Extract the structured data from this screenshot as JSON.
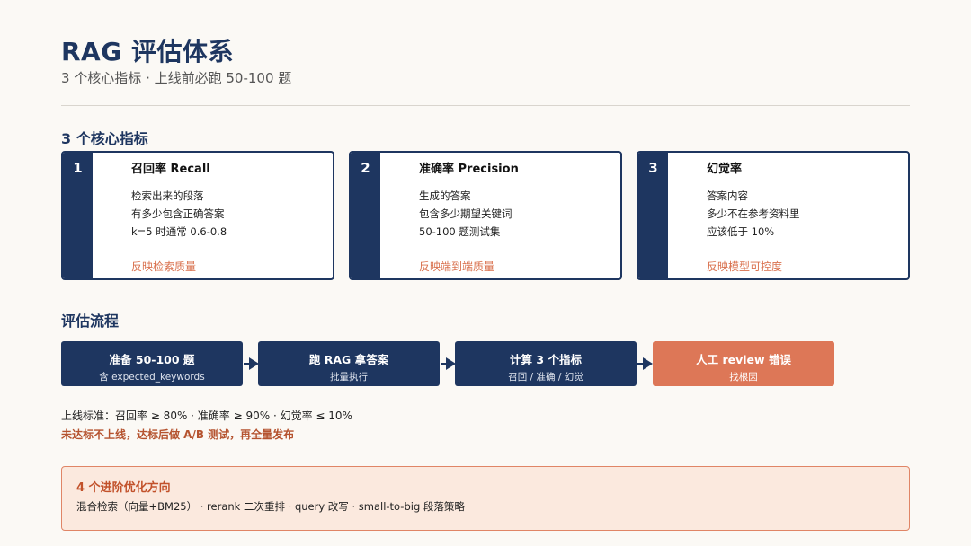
{
  "header": {
    "title": "RAG 评估体系",
    "subtitle": "3 个核心指标 · 上线前必跑 50-100 题"
  },
  "metrics_section": {
    "title": "3 个核心指标",
    "cards": [
      {
        "number": "1",
        "title": "召回率 Recall",
        "lines": [
          "检索出来的段落",
          "有多少包含正确答案",
          "k=5 时通常 0.6-0.8"
        ],
        "note": "反映检索质量"
      },
      {
        "number": "2",
        "title": "准确率 Precision",
        "lines": [
          "生成的答案",
          "包含多少期望关键词",
          "50-100 题测试集"
        ],
        "note": "反映端到端质量"
      },
      {
        "number": "3",
        "title": "幻觉率",
        "lines": [
          "答案内容",
          "多少不在参考资料里",
          "应该低于 10%"
        ],
        "note": "反映模型可控度"
      }
    ]
  },
  "flow_section": {
    "title": "评估流程",
    "steps": [
      {
        "main": "准备 50-100 题",
        "sub": "含 expected_keywords"
      },
      {
        "main": "跑 RAG 拿答案",
        "sub": "批量执行"
      },
      {
        "main": "计算 3 个指标",
        "sub": "召回 / 准确 / 幻觉"
      },
      {
        "main": "人工 review 错误",
        "sub": "找根因"
      }
    ],
    "standard": "上线标准：召回率 ≥ 80% · 准确率 ≥ 90% · 幻觉率 ≤ 10%",
    "warning": "未达标不上线，达标后做 A/B 测试，再全量发布"
  },
  "advanced": {
    "title": "4 个进阶优化方向",
    "body": "混合检索（向量+BM25） · rerank 二次重排 · query 改写 · small-to-big 段落策略"
  },
  "colors": {
    "navy": "#1e3660",
    "accent": "#dd7757",
    "callout_bg": "#fbe9de"
  }
}
